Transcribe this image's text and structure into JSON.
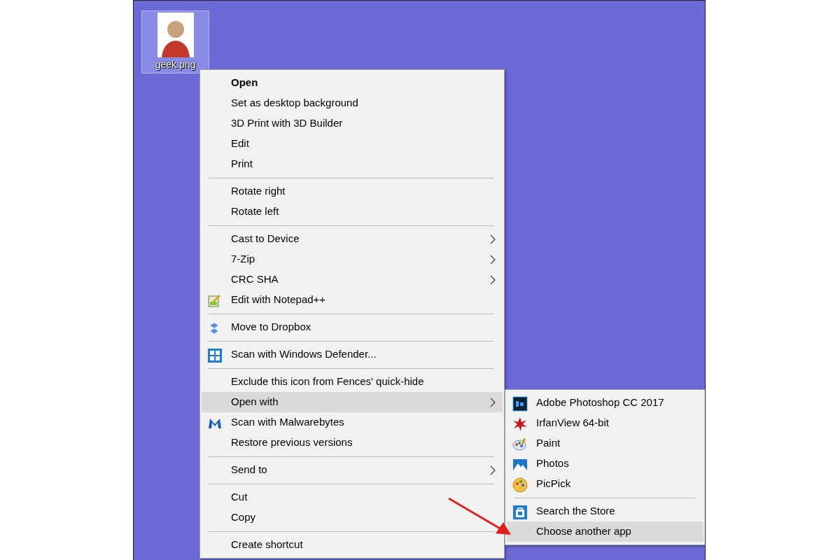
{
  "desktop_icon": {
    "label": "geek.png",
    "selected": true
  },
  "context_menu": [
    {
      "kind": "item",
      "label": "Open",
      "bold": true,
      "selected": false
    },
    {
      "kind": "item",
      "label": "Set as desktop background",
      "selected": false
    },
    {
      "kind": "item",
      "label": "3D Print with 3D Builder",
      "selected": false
    },
    {
      "kind": "item",
      "label": "Edit",
      "selected": false
    },
    {
      "kind": "item",
      "label": "Print",
      "selected": false
    },
    {
      "kind": "separator"
    },
    {
      "kind": "item",
      "label": "Rotate right",
      "selected": false
    },
    {
      "kind": "item",
      "label": "Rotate left",
      "selected": false
    },
    {
      "kind": "separator"
    },
    {
      "kind": "item",
      "label": "Cast to Device",
      "submenu": true,
      "selected": false
    },
    {
      "kind": "item",
      "label": "7-Zip",
      "submenu": true,
      "selected": false
    },
    {
      "kind": "item",
      "label": "CRC SHA",
      "submenu": true,
      "selected": false
    },
    {
      "kind": "item",
      "label": "Edit with Notepad++",
      "selected": false
    },
    {
      "kind": "separator"
    },
    {
      "kind": "item",
      "label": "Move to Dropbox",
      "selected": false
    },
    {
      "kind": "separator"
    },
    {
      "kind": "item",
      "label": "Scan with Windows Defender...",
      "selected": false
    },
    {
      "kind": "separator"
    },
    {
      "kind": "item",
      "label": "Exclude this icon from Fences' quick-hide",
      "selected": false
    },
    {
      "kind": "item",
      "label": "Open with",
      "submenu": true,
      "selected": true
    },
    {
      "kind": "item",
      "label": "Scan with Malwarebytes",
      "selected": false
    },
    {
      "kind": "item",
      "label": "Restore previous versions",
      "selected": false
    },
    {
      "kind": "separator"
    },
    {
      "kind": "item",
      "label": "Send to",
      "submenu": true,
      "selected": false
    },
    {
      "kind": "separator"
    },
    {
      "kind": "item",
      "label": "Cut",
      "selected": false
    },
    {
      "kind": "item",
      "label": "Copy",
      "selected": false
    },
    {
      "kind": "separator"
    },
    {
      "kind": "item",
      "label": "Create shortcut",
      "selected": false
    }
  ],
  "open_with_submenu": [
    {
      "kind": "item",
      "label": "Adobe Photoshop CC 2017",
      "selected": false
    },
    {
      "kind": "item",
      "label": "IrfanView 64-bit",
      "selected": false
    },
    {
      "kind": "item",
      "label": "Paint",
      "selected": false
    },
    {
      "kind": "item",
      "label": "Photos",
      "selected": false
    },
    {
      "kind": "item",
      "label": "PicPick",
      "selected": false
    },
    {
      "kind": "separator"
    },
    {
      "kind": "item",
      "label": "Search the Store",
      "selected": false
    },
    {
      "kind": "item",
      "label": "Choose another app",
      "selected": true
    }
  ]
}
